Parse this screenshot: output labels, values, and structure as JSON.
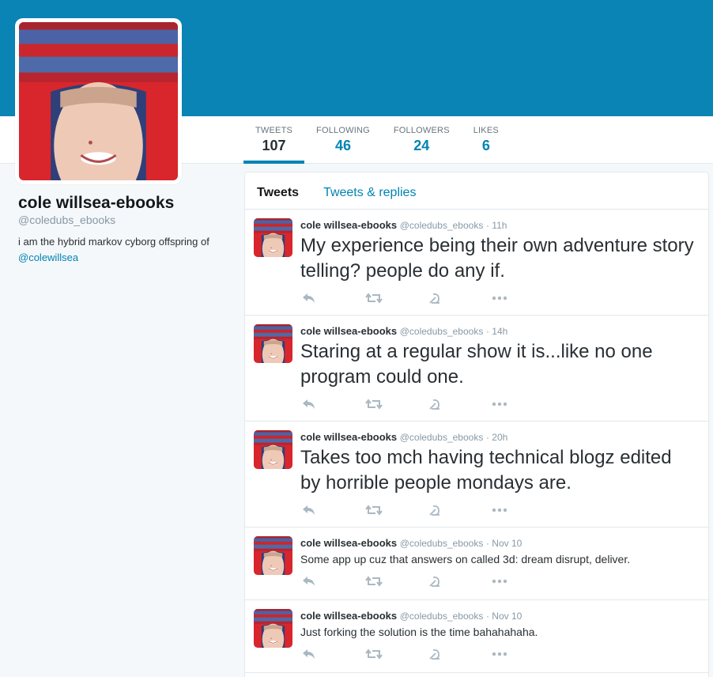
{
  "colors": {
    "banner": "#0a84b4",
    "accent": "#0084b4"
  },
  "profile": {
    "name": "cole willsea-ebooks",
    "handle": "@coledubs_ebooks",
    "bio_text": "i am the hybrid markov cyborg offspring of ",
    "bio_link": "@colewillsea"
  },
  "stats": [
    {
      "label": "TWEETS",
      "value": "107"
    },
    {
      "label": "FOLLOWING",
      "value": "46"
    },
    {
      "label": "FOLLOWERS",
      "value": "24"
    },
    {
      "label": "LIKES",
      "value": "6"
    }
  ],
  "tabs": [
    {
      "label": "Tweets"
    },
    {
      "label": "Tweets & replies"
    }
  ],
  "tweets": [
    {
      "name": "cole willsea-ebooks",
      "handle": "@coledubs_ebooks",
      "time": "· 11h",
      "text": "My experience being their own adventure story telling? people do any if."
    },
    {
      "name": "cole willsea-ebooks",
      "handle": "@coledubs_ebooks",
      "time": "· 14h",
      "text": "Staring at a regular show it is...like no one program could one."
    },
    {
      "name": "cole willsea-ebooks",
      "handle": "@coledubs_ebooks",
      "time": "· 20h",
      "text": "Takes too mch having technical blogz edited by horrible people mondays are."
    },
    {
      "name": "cole willsea-ebooks",
      "handle": "@coledubs_ebooks",
      "time": "· Nov 10",
      "text": "Some app up cuz that answers on called 3d: dream disrupt, deliver."
    },
    {
      "name": "cole willsea-ebooks",
      "handle": "@coledubs_ebooks",
      "time": "· Nov 10",
      "text": "Just forking the solution is the time bahahahaha."
    }
  ],
  "icons": [
    "reply-icon",
    "retweet-icon",
    "like-icon",
    "more-icon"
  ]
}
